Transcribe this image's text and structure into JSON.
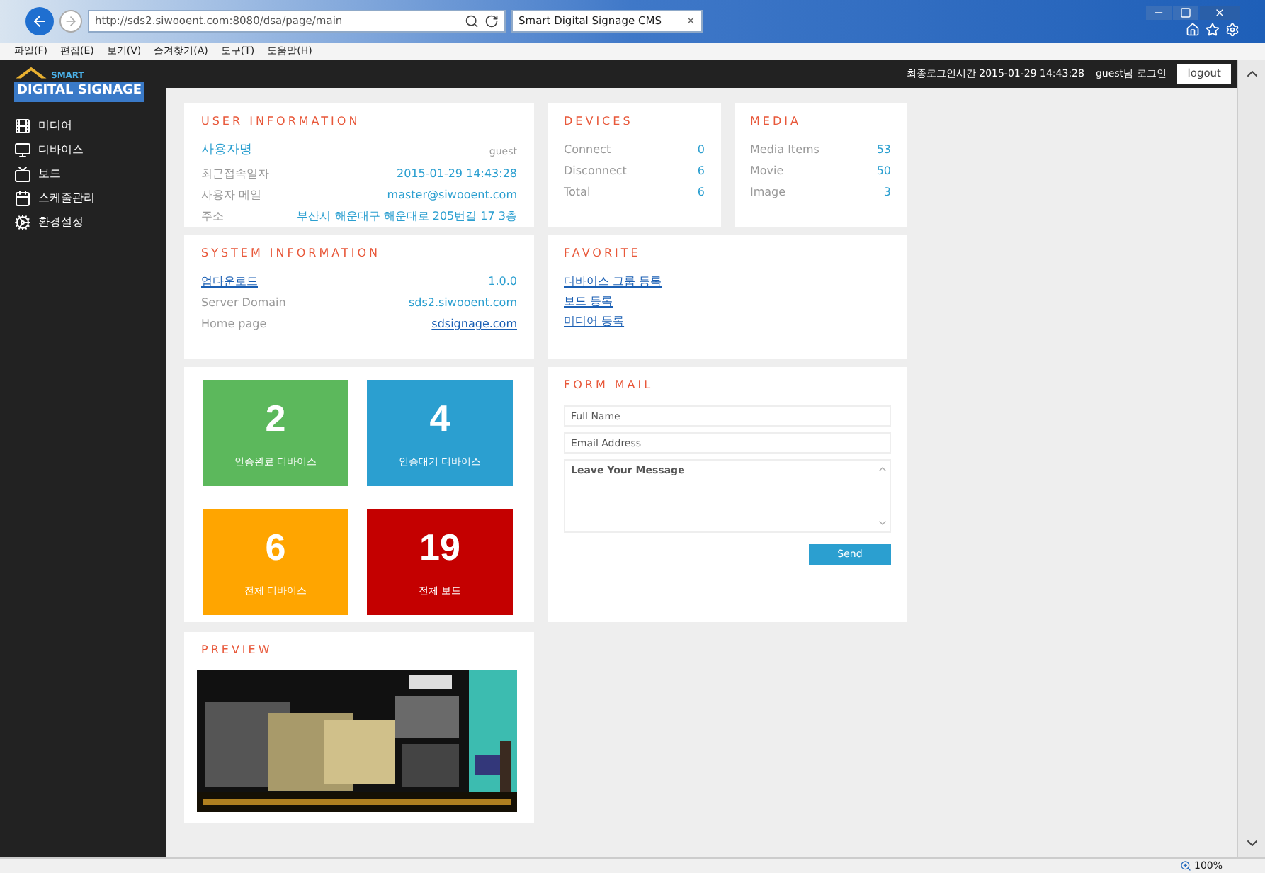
{
  "browser": {
    "url": "http://sds2.siwooent.com:8080/dsa/page/main",
    "tab_title": "Smart Digital Signage CMS",
    "tab_close": "×",
    "menu": [
      "파일(F)",
      "편집(E)",
      "보기(V)",
      "즐겨찾기(A)",
      "도구(T)",
      "도움말(H)"
    ],
    "zoom": "100%"
  },
  "logo": {
    "small": "SMART",
    "main": "DIGITAL SIGNAGE"
  },
  "header": {
    "last_login": "최종로그인시간 2015-01-29 14:43:28",
    "user": "guest님 로그인",
    "logout": "logout"
  },
  "sidebar": {
    "items": [
      {
        "label": "미디어",
        "kind": "media"
      },
      {
        "label": "디바이스",
        "kind": "device"
      },
      {
        "label": "보드",
        "kind": "board"
      },
      {
        "label": "스케줄관리",
        "kind": "schedule"
      },
      {
        "label": "환경설정",
        "kind": "settings"
      }
    ]
  },
  "user_information": {
    "title": "USER INFORMATION",
    "name": "사용자명",
    "role": "guest",
    "rows": [
      {
        "label": "최근접속일자",
        "value": "2015-01-29 14:43:28"
      },
      {
        "label": "사용자 메일",
        "value": "master@siwooent.com"
      },
      {
        "label": "주소",
        "value": "부산시 해운대구 해운대로 205번길 17 3층"
      }
    ]
  },
  "devices": {
    "title": "DEVICES",
    "rows": [
      {
        "label": "Connect",
        "value": "0"
      },
      {
        "label": "Disconnect",
        "value": "6"
      },
      {
        "label": "Total",
        "value": "6"
      }
    ]
  },
  "media": {
    "title": "MEDIA",
    "rows": [
      {
        "label": "Media Items",
        "value": "53"
      },
      {
        "label": "Movie",
        "value": "50"
      },
      {
        "label": "Image",
        "value": "3"
      }
    ]
  },
  "system_information": {
    "title": "SYSTEM INFORMATION",
    "rows": [
      {
        "label": "업다운로드",
        "value": "1.0.0",
        "kind": "link-label"
      },
      {
        "label": "Server Domain",
        "value": "sds2.siwooent.com",
        "kind": "plain"
      },
      {
        "label": "Home page",
        "value": "sdsignage.com",
        "kind": "link-value"
      }
    ]
  },
  "favorite": {
    "title": "FAVORITE",
    "links": [
      "디바이스 그룹 등록",
      "보드 등록",
      "미디어 등록"
    ]
  },
  "tiles": [
    {
      "number": "2",
      "label": "인증완료 디바이스",
      "color": "#5cb85c"
    },
    {
      "number": "4",
      "label": "인증대기 디바이스",
      "color": "#2b9fd0"
    },
    {
      "number": "6",
      "label": "전체 디바이스",
      "color": "#ffa500"
    },
    {
      "number": "19",
      "label": "전체 보드",
      "color": "#c40000"
    }
  ],
  "form_mail": {
    "title": "FORM MAIL",
    "fields": [
      {
        "placeholder": "Full Name"
      },
      {
        "placeholder": "Email Address"
      }
    ],
    "message_placeholder": "Leave Your Message",
    "send": "Send"
  },
  "preview": {
    "title": "PREVIEW",
    "kind": "picture"
  }
}
